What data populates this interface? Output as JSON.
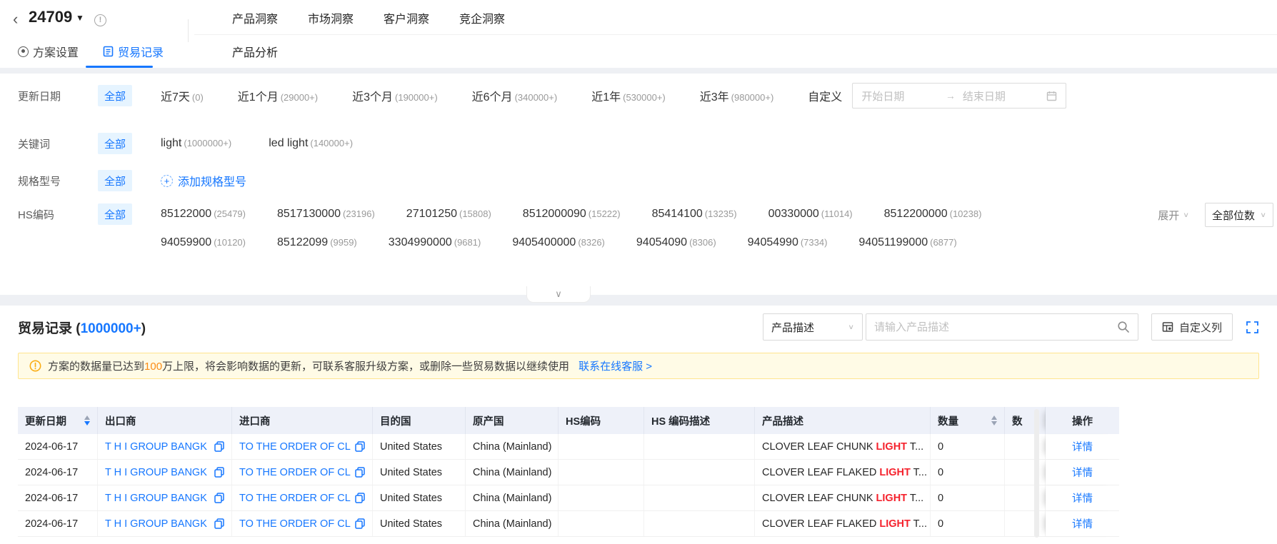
{
  "glyphs": {
    "back": "‹",
    "caret_down": "▼",
    "chevron_down": "∨",
    "range_arrow": "→",
    "info_mark": "!",
    "plus_mark": "+"
  },
  "topbar": {
    "plan_id": "24709",
    "nav_tabs": [
      "产品洞察",
      "市场洞察",
      "客户洞察",
      "竞企洞察"
    ],
    "sub_tab": "产品分析",
    "plan_tabs": {
      "settings": "方案设置",
      "records": "贸易记录"
    }
  },
  "filters": {
    "update_date": {
      "label": "更新日期",
      "all": "全部",
      "options": [
        {
          "label": "近7天",
          "count": "(0)"
        },
        {
          "label": "近1个月",
          "count": "(29000+)"
        },
        {
          "label": "近3个月",
          "count": "(190000+)"
        },
        {
          "label": "近6个月",
          "count": "(340000+)"
        },
        {
          "label": "近1年",
          "count": "(530000+)"
        },
        {
          "label": "近3年",
          "count": "(980000+)"
        }
      ],
      "custom_label": "自定义",
      "start_placeholder": "开始日期",
      "end_placeholder": "结束日期"
    },
    "keyword": {
      "label": "关键词",
      "all": "全部",
      "options": [
        {
          "label": "light",
          "count": "(1000000+)"
        },
        {
          "label": "led light",
          "count": "(140000+)"
        }
      ]
    },
    "spec": {
      "label": "规格型号",
      "all": "全部",
      "add_label": "添加规格型号"
    },
    "hs_code": {
      "label": "HS编码",
      "all": "全部",
      "row1": [
        {
          "code": "85122000",
          "count": "(25479)"
        },
        {
          "code": "8517130000",
          "count": "(23196)"
        },
        {
          "code": "27101250",
          "count": "(15808)"
        },
        {
          "code": "8512000090",
          "count": "(15222)"
        },
        {
          "code": "85414100",
          "count": "(13235)"
        },
        {
          "code": "00330000",
          "count": "(11014)"
        },
        {
          "code": "8512200000",
          "count": "(10238)"
        }
      ],
      "row2": [
        {
          "code": "94059900",
          "count": "(10120)"
        },
        {
          "code": "85122099",
          "count": "(9959)"
        },
        {
          "code": "3304990000",
          "count": "(9681)"
        },
        {
          "code": "9405400000",
          "count": "(8326)"
        },
        {
          "code": "94054090",
          "count": "(8306)"
        },
        {
          "code": "94054990",
          "count": "(7334)"
        },
        {
          "code": "94051199000",
          "count": "(6877)"
        }
      ],
      "expand_label": "展开",
      "digits_select": "全部位数"
    }
  },
  "records": {
    "title_prefix": "贸易记录 (",
    "count": "1000000+",
    "title_suffix": ")",
    "search_select": "产品描述",
    "search_placeholder": "请输入产品描述",
    "custom_columns_label": "自定义列",
    "alert": {
      "part1": "方案的数据量已达到",
      "highlight": "100",
      "part2": "万上限，将会影响数据的更新，可联系客服升级方案，或删除一些贸易数据以继续使用",
      "link": "联系在线客服 >"
    },
    "table": {
      "columns": [
        "更新日期",
        "出口商",
        "进口商",
        "目的国",
        "原产国",
        "HS编码",
        "HS 编码描述",
        "产品描述",
        "数量",
        "数",
        "操作"
      ],
      "rows": [
        {
          "date": "2024-06-17",
          "exporter": "T H I GROUP BANGK",
          "importer": "TO THE ORDER OF CL",
          "destination": "United States",
          "origin": "China (Mainland)",
          "hs_code": "",
          "hs_desc": "",
          "product_prefix": "CLOVER LEAF CHUNK ",
          "product_highlight": "LIGHT",
          "product_suffix": " T...",
          "quantity": "0",
          "action": "详情"
        },
        {
          "date": "2024-06-17",
          "exporter": "T H I GROUP BANGK",
          "importer": "TO THE ORDER OF CL",
          "destination": "United States",
          "origin": "China (Mainland)",
          "hs_code": "",
          "hs_desc": "",
          "product_prefix": "CLOVER LEAF FLAKED ",
          "product_highlight": "LIGHT",
          "product_suffix": " T...",
          "quantity": "0",
          "action": "详情"
        },
        {
          "date": "2024-06-17",
          "exporter": "T H I GROUP BANGK",
          "importer": "TO THE ORDER OF CL",
          "destination": "United States",
          "origin": "China (Mainland)",
          "hs_code": "",
          "hs_desc": "",
          "product_prefix": "CLOVER LEAF CHUNK ",
          "product_highlight": "LIGHT",
          "product_suffix": " T...",
          "quantity": "0",
          "action": "详情"
        },
        {
          "date": "2024-06-17",
          "exporter": "T H I GROUP BANGK",
          "importer": "TO THE ORDER OF CL",
          "destination": "United States",
          "origin": "China (Mainland)",
          "hs_code": "",
          "hs_desc": "",
          "product_prefix": "CLOVER LEAF FLAKED ",
          "product_highlight": "LIGHT",
          "product_suffix": " T...",
          "quantity": "0",
          "action": "详情"
        }
      ]
    }
  },
  "colors": {
    "accent": "#1677ff",
    "warning": "#faad14",
    "highlight_red": "#f5222d"
  }
}
